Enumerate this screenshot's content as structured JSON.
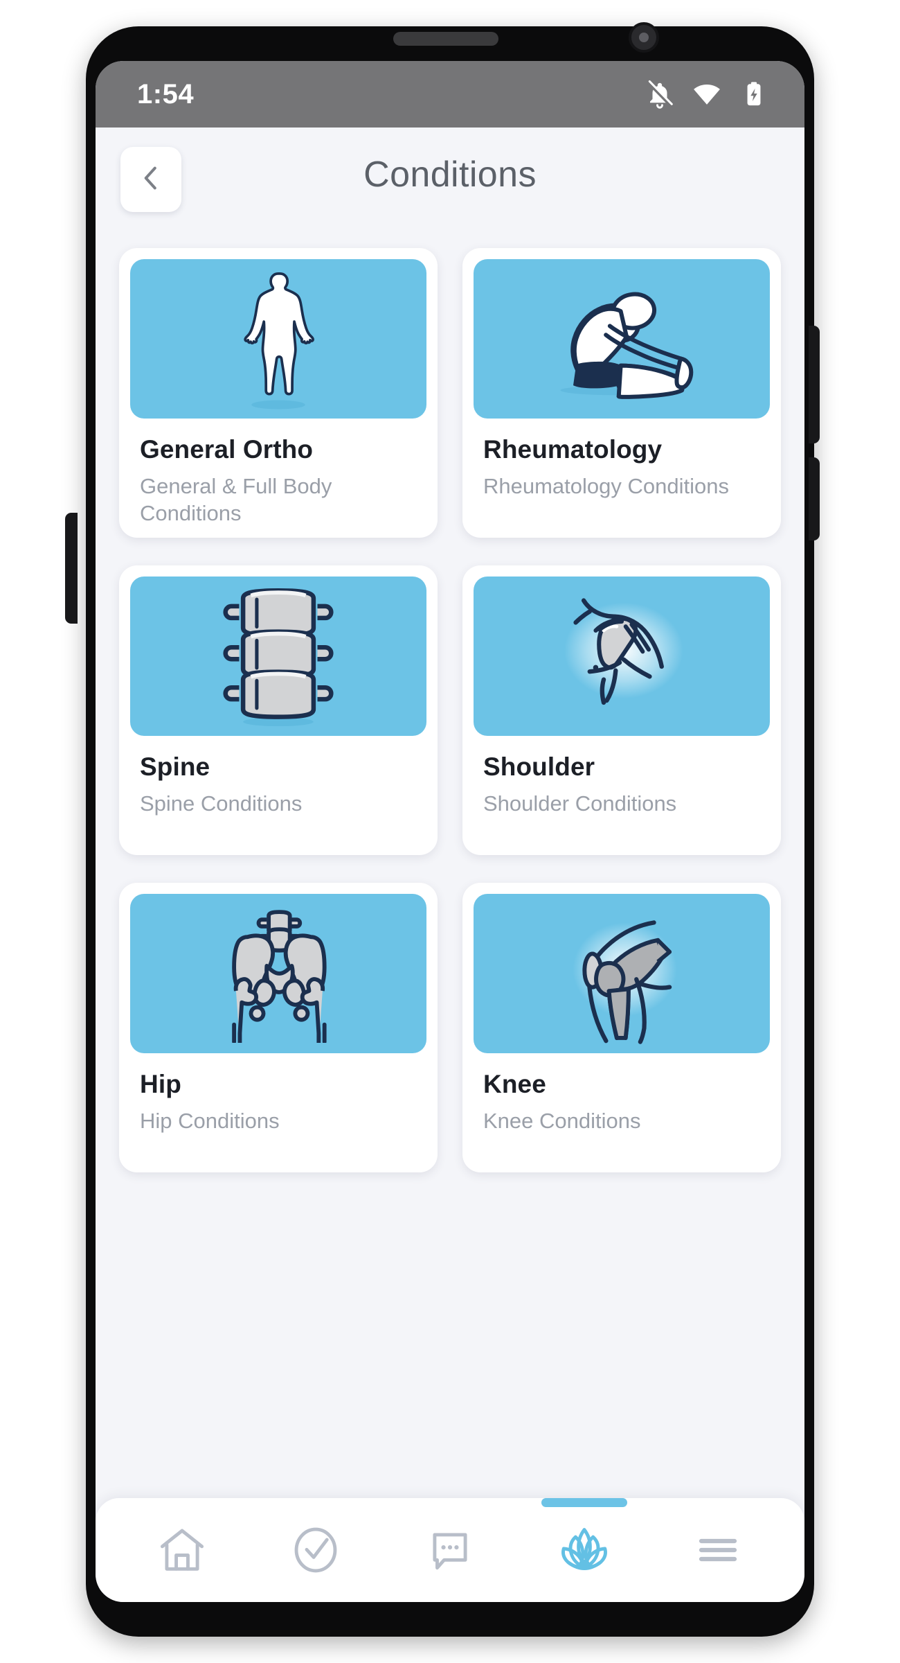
{
  "status_bar": {
    "time": "1:54",
    "icons": [
      "notifications-off-icon",
      "wifi-icon",
      "battery-charging-icon"
    ]
  },
  "header": {
    "title": "Conditions",
    "back_icon": "chevron-left-icon"
  },
  "cards": [
    {
      "title": "General Ortho",
      "subtitle": "General & Full Body Conditions",
      "image": "full-body-silhouette-illustration"
    },
    {
      "title": "Rheumatology",
      "subtitle": "Rheumatology Conditions",
      "image": "seated-forward-fold-stretch-illustration"
    },
    {
      "title": "Spine",
      "subtitle": "Spine Conditions",
      "image": "vertebrae-stack-illustration"
    },
    {
      "title": "Shoulder",
      "subtitle": "Shoulder Conditions",
      "image": "shoulder-joint-anatomy-illustration"
    },
    {
      "title": "Hip",
      "subtitle": "Hip Conditions",
      "image": "pelvis-bones-illustration"
    },
    {
      "title": "Knee",
      "subtitle": "Knee Conditions",
      "image": "knee-joint-anatomy-illustration"
    }
  ],
  "bottom_nav": {
    "items": [
      {
        "icon": "home-icon",
        "active": false
      },
      {
        "icon": "check-circle-icon",
        "active": false
      },
      {
        "icon": "chat-bubble-icon",
        "active": false
      },
      {
        "icon": "lotus-icon",
        "active": true
      },
      {
        "icon": "hamburger-menu-icon",
        "active": false
      }
    ]
  },
  "colors": {
    "accent_blue": "#6cc3e6",
    "thumb_blue": "#6cc3e6",
    "illustration_outline": "#1b2f4e",
    "bone_gray": "#d2d3d5",
    "screen_bg": "#f4f5f9",
    "status_bar_bg": "#757577",
    "title_text": "#5b6068",
    "card_title_text": "#1c1f26",
    "card_sub_text": "#9a9fa8",
    "nav_inactive": "#b8bec9"
  }
}
